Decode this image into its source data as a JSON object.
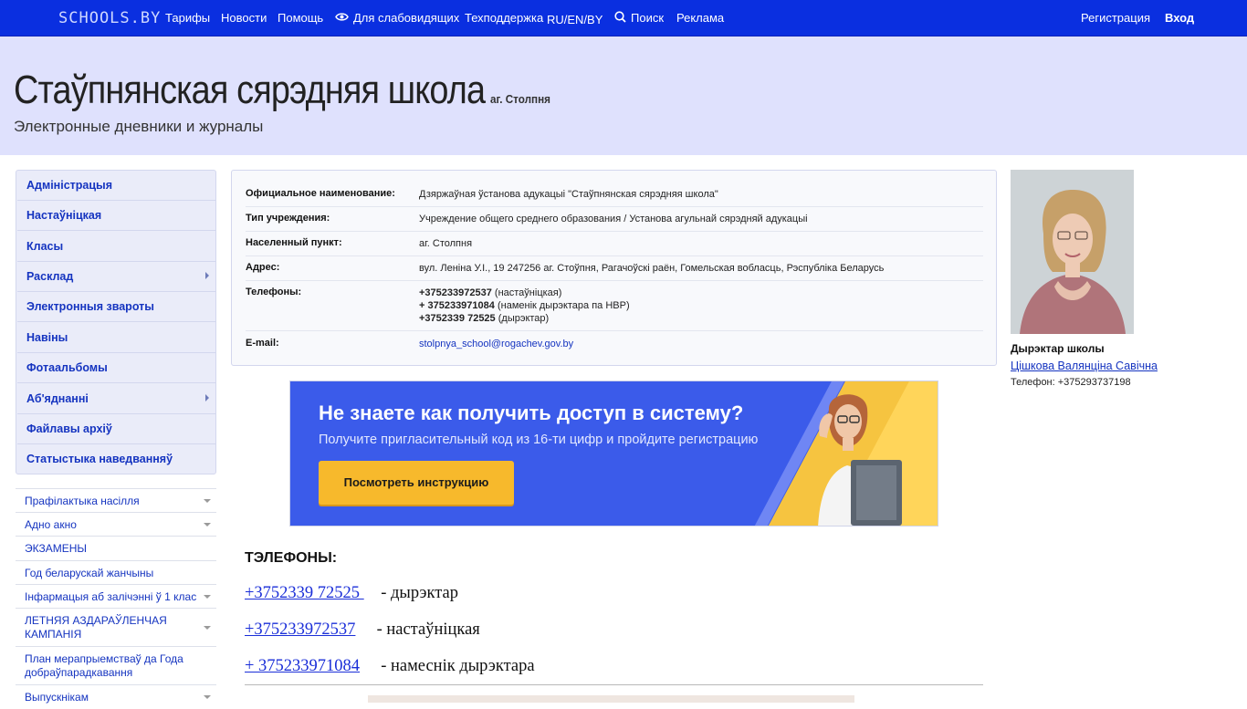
{
  "topbar": {
    "logo": "SCHOOLS.BY",
    "nav": {
      "tariffs": "Тарифы",
      "news": "Новости",
      "help": "Помощь",
      "low_vision": "Для слабовидящих",
      "support": "Техподдержка",
      "langs": "RU/EN/BY",
      "search": "Поиск",
      "ads": "Реклама"
    },
    "register": "Регистрация",
    "login": "Вход"
  },
  "header": {
    "title": "Стаўпнянская сярэдняя школа",
    "place": "аг. Столпня",
    "subtitle": "Электронные дневники и журналы"
  },
  "sidebar": {
    "menu": [
      {
        "label": "Адміністрацыя",
        "has_submenu": false
      },
      {
        "label": "Настаўніцкая",
        "has_submenu": false
      },
      {
        "label": "Класы",
        "has_submenu": false
      },
      {
        "label": "Расклад",
        "has_submenu": true
      },
      {
        "label": "Электронныя звароты",
        "has_submenu": false
      },
      {
        "label": "Навіны",
        "has_submenu": false
      },
      {
        "label": "Фотаальбомы",
        "has_submenu": false
      },
      {
        "label": "Аб'яднанні",
        "has_submenu": true
      },
      {
        "label": "Файлавы архіў",
        "has_submenu": false
      },
      {
        "label": "Статыстыка наведванняў",
        "has_submenu": false
      }
    ],
    "pages": [
      {
        "label": "Прафілактыка насілля",
        "expandable": true
      },
      {
        "label": "Адно акно",
        "expandable": true
      },
      {
        "label": "ЭКЗАМЕНЫ",
        "expandable": false
      },
      {
        "label": "Год беларускай жанчыны",
        "expandable": false
      },
      {
        "label": "Інфармацыя аб залічэнні ў 1 клас",
        "expandable": true
      },
      {
        "label": "ЛЕТНЯЯ АЗДАРАЎЛЕНЧАЯ КАМПАНІЯ",
        "expandable": true
      },
      {
        "label": "План мерапрыемстваў да Года добраўпарадкавання",
        "expandable": false
      },
      {
        "label": "Выпускнікам",
        "expandable": true
      }
    ]
  },
  "info": {
    "official_name_label": "Официальное наименование:",
    "official_name": "Дзяржаўная ўстанова адукацыі \"Стаўпнянская сярэдняя школа\"",
    "type_label": "Тип учреждения:",
    "type": "Учреждение общего среднего образования / Установа агульнай сярэдняй адукацыі",
    "locality_label": "Населенный пункт:",
    "locality": "аг. Столпня",
    "address_label": "Адрес:",
    "address": "вул. Леніна У.І., 19 247256 аг. Стоўпня, Рагачоўскі раён, Гомельская вобласць, Рэспубліка Беларусь",
    "phones_label": "Телефоны:",
    "phones": [
      {
        "number": "+375233972537",
        "note": "(настаўніцкая)"
      },
      {
        "number": "+ 375233971084",
        "note": "(наменік дырэктара па НВР)"
      },
      {
        "number": "+37523З9 72525",
        "note": "(дырэктар)"
      }
    ],
    "email_label": "E-mail:",
    "email": "stolpnya_school@rogachev.gov.by"
  },
  "banner": {
    "title": "Не знаете как получить доступ в систему?",
    "subtitle": "Получите пригласительный код из 16-ти цифр и пройдите регистрацию",
    "button": "Посмотреть инструкцию"
  },
  "director": {
    "role": "Дырэктар школы",
    "name": "Цішкова Валянціна Савічна",
    "phone": "Телефон: +375293737198"
  },
  "phones_section": {
    "heading": "ТЭЛЕФОНЫ:",
    "lines": [
      {
        "number": "+3752339 72525 ",
        "role": "- дырэктар"
      },
      {
        "number": "+375233972537",
        "role": "- настаўніцкая"
      },
      {
        "number": "+ 375233971084",
        "role": "- намеснік дырэктара"
      }
    ]
  },
  "colors": {
    "topbar": "#0a2fe0",
    "header_band": "#dfe1fd",
    "link": "#1534c0",
    "banner_blue": "#3b5bea",
    "banner_button": "#f7b92c"
  }
}
